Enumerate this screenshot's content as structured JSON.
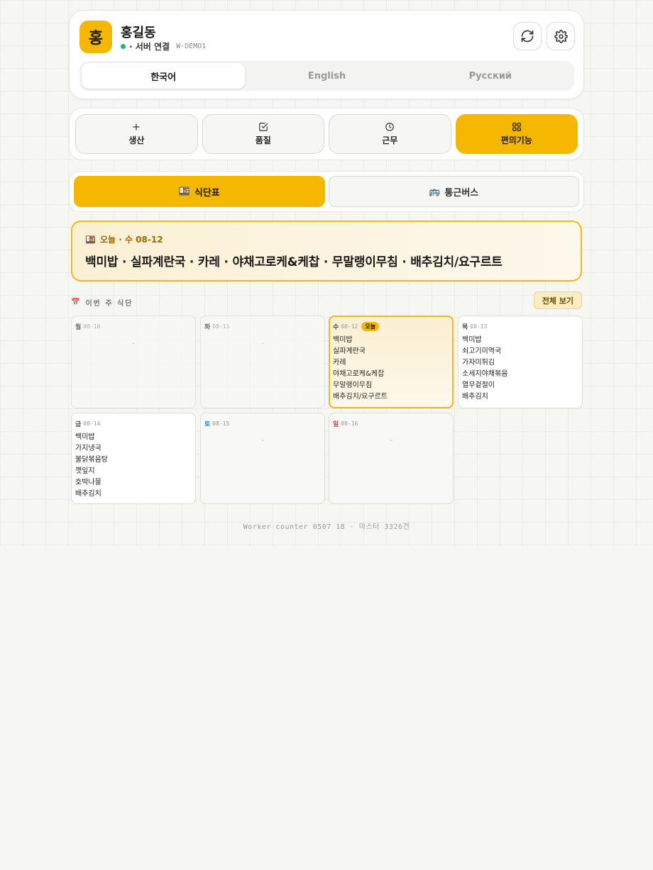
{
  "header": {
    "avatar_initial": "홍",
    "user_name": "홍길동",
    "status_text": "· 서버 연결",
    "worker_id": "W-DEMO1"
  },
  "languages": [
    {
      "label": "한국어",
      "active": true
    },
    {
      "label": "English",
      "active": false
    },
    {
      "label": "Русский",
      "active": false
    }
  ],
  "nav": [
    {
      "label": "생산",
      "icon": "plus-icon",
      "active": false
    },
    {
      "label": "품질",
      "icon": "checkbox-icon",
      "active": false
    },
    {
      "label": "근무",
      "icon": "clock-icon",
      "active": false
    },
    {
      "label": "편의기능",
      "icon": "grid-icon",
      "active": true
    }
  ],
  "subtabs": [
    {
      "label": "식단표",
      "icon": "🍱",
      "active": true
    },
    {
      "label": "통근버스",
      "icon": "🚌",
      "active": false
    }
  ],
  "today": {
    "icon": "🍱",
    "label": "오늘 · 수 08-12",
    "menu": "백미밥 · 실파계란국 · 카레 · 야채고로케&케찹 · 무말랭이무침 · 배추김치/요구르트"
  },
  "week": {
    "icon": "📅",
    "title": "이번 주 식단",
    "view_all": "전체 보기",
    "days": [
      {
        "weekday": "월",
        "date": "08-10",
        "items": [],
        "empty": "-"
      },
      {
        "weekday": "화",
        "date": "08-11",
        "items": [],
        "empty": "-"
      },
      {
        "weekday": "수",
        "date": "08-12",
        "badge": "오늘",
        "items": [
          "백미밥",
          "실파계란국",
          "카레",
          "야채고로케&케찹",
          "무말랭이무침",
          "배추김치/요구르트"
        ]
      },
      {
        "weekday": "목",
        "date": "08-13",
        "items": [
          "백미밥",
          "쇠고기미역국",
          "가자미튀김",
          "소세지야채볶음",
          "열무겉절이",
          "배추김치"
        ]
      },
      {
        "weekday": "금",
        "date": "08-14",
        "items": [
          "백미밥",
          "가지냉국",
          "불닭볶음탕",
          "깻잎지",
          "호박나물",
          "배추김치"
        ]
      },
      {
        "weekday": "토",
        "date": "08-15",
        "items": [],
        "empty": "-"
      },
      {
        "weekday": "일",
        "date": "08-16",
        "items": [],
        "empty": "-"
      }
    ]
  },
  "footer": "Worker counter 0507 18 · 마스터 3326건",
  "colors": {
    "accent": "#f5b700",
    "online": "#1db86a",
    "saturday": "#2a7fcf",
    "sunday": "#d13a3a"
  }
}
